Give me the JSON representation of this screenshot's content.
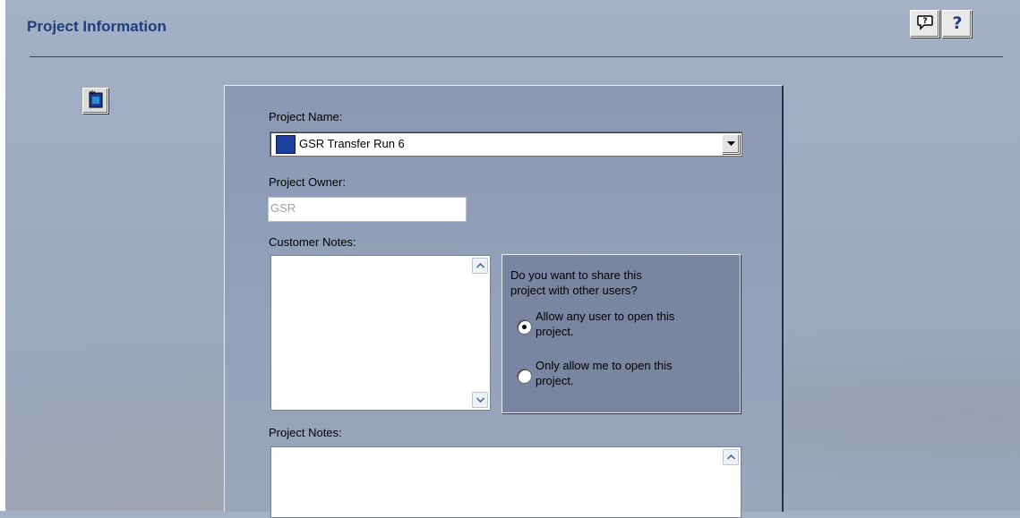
{
  "header": {
    "title": "Project Information",
    "buttons": [
      {
        "name": "chat-help-icon"
      },
      {
        "name": "help-question-icon"
      }
    ]
  },
  "side_icon": "project-icon",
  "form": {
    "project_name_label": "Project Name:",
    "project_name_value": "GSR Transfer Run 6",
    "project_owner_label": "Project Owner:",
    "project_owner_value": "GSR",
    "customer_notes_label": "Customer Notes:",
    "customer_notes_value": "",
    "project_notes_label": "Project Notes:",
    "project_notes_value": ""
  },
  "share": {
    "question_line1": "Do you want to share this",
    "question_line2": "project with other users?",
    "options": [
      {
        "line1": "Allow any user to open this",
        "line2": "project.",
        "selected": true
      },
      {
        "line1": "Only allow me to open this",
        "line2": "project.",
        "selected": false
      }
    ]
  },
  "colors": {
    "title": "#1e3f7a",
    "panel": "#8f9cb6",
    "share_box": "#7a86a1"
  }
}
